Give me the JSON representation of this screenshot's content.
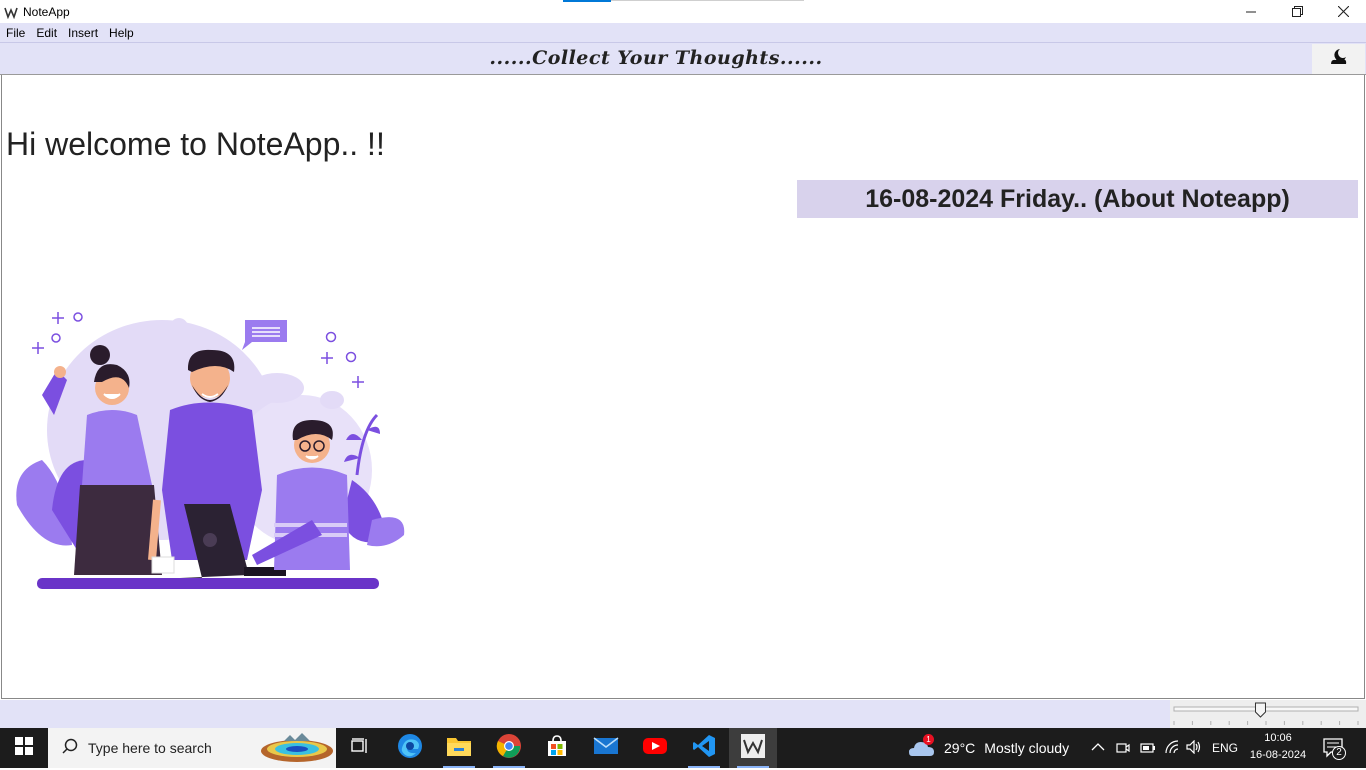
{
  "window": {
    "title": "NoteApp",
    "controls": {
      "minimize": "—",
      "restore": "❐",
      "close": "✕"
    }
  },
  "menu": {
    "items": [
      {
        "label": "File"
      },
      {
        "label": "Edit"
      },
      {
        "label": "Insert"
      },
      {
        "label": "Help"
      }
    ]
  },
  "banner": {
    "text": "......Collect Your Thoughts......",
    "theme_icon": "moon-cloud-icon"
  },
  "main": {
    "welcome": "Hi welcome to NoteApp.. !!",
    "date_info": "16-08-2024 Friday.. (About Noteapp)",
    "illustration": "team-illustration"
  },
  "statusbar": {
    "zoom_slider_value": 0.47
  },
  "taskbar": {
    "search_placeholder": "Type here to search",
    "weather": {
      "badge": "1",
      "temp": "29°C",
      "condition": "Mostly cloudy"
    },
    "language": "ENG",
    "time": "10:06",
    "date": "16-08-2024",
    "notifications": "2",
    "pinned_icons": [
      "task-view-icon",
      "edge-icon",
      "file-explorer-icon",
      "chrome-icon",
      "store-icon",
      "mail-icon",
      "youtube-icon",
      "vscode-icon",
      "noteapp-icon"
    ]
  },
  "colors": {
    "menu_bg": "#e2e2f7",
    "date_bar_bg": "#d8d2ec",
    "illustration_purple": "#7b4fe0",
    "taskbar_bg": "#1c1c1c"
  }
}
